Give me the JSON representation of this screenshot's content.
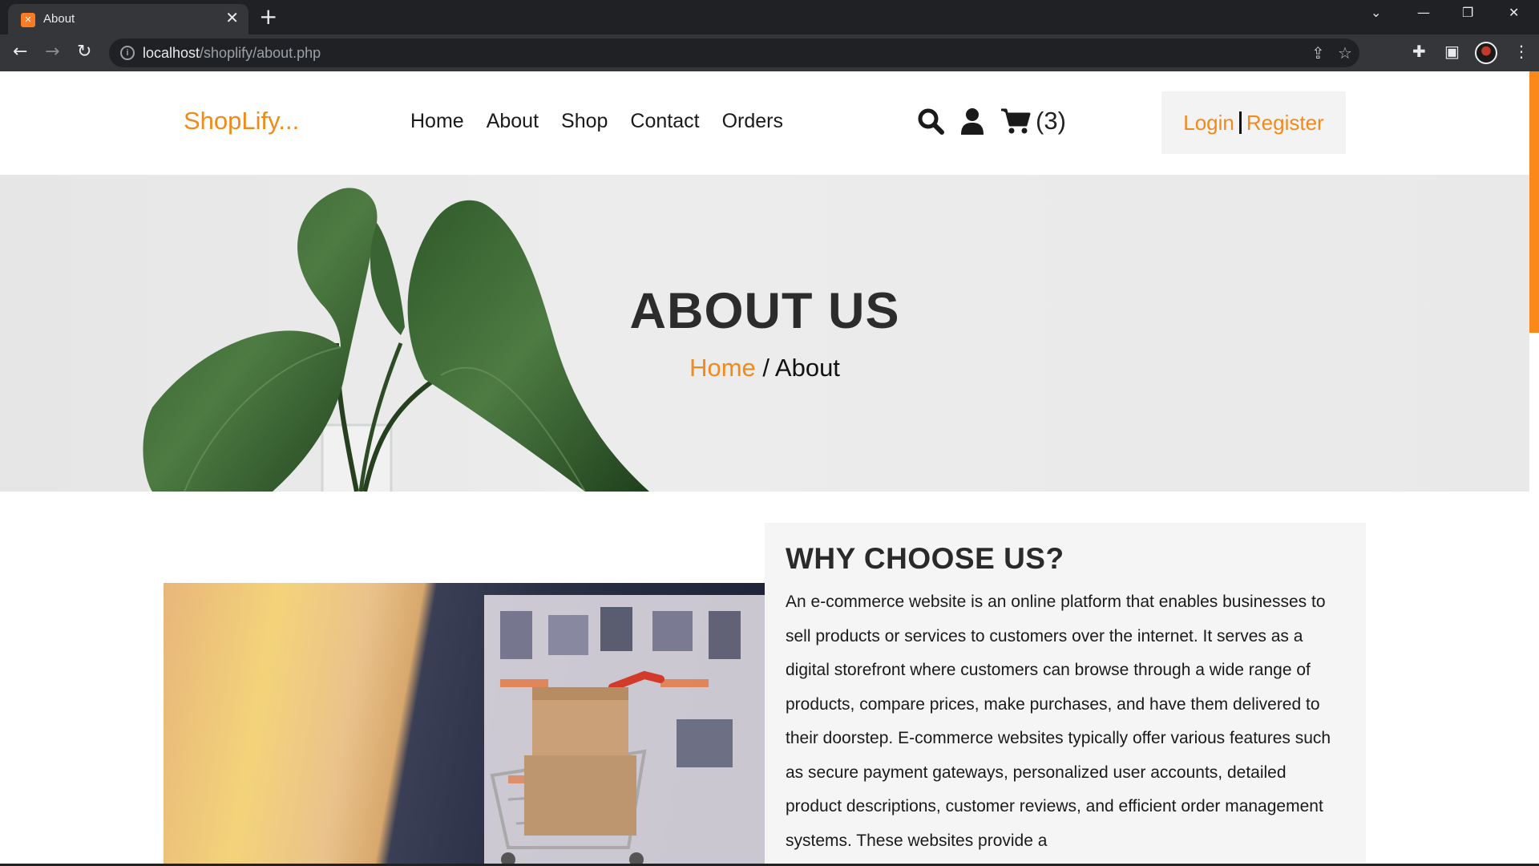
{
  "browser": {
    "tab_title": "About",
    "tab_favicon": "xampp-icon",
    "url_host": "localhost",
    "url_path": "/shoplify/about.php"
  },
  "site": {
    "logo": "ShopLify...",
    "nav": [
      "Home",
      "About",
      "Shop",
      "Contact",
      "Orders"
    ],
    "cart_count": "(3)",
    "login": "Login",
    "register": "Register",
    "accent_color": "#f28a1a"
  },
  "hero": {
    "title": "ABOUT US",
    "breadcrumb_home": "Home",
    "breadcrumb_sep": " / ",
    "breadcrumb_current": "About"
  },
  "about": {
    "title": "WHY CHOOSE US?",
    "text": "An e-commerce website is an online platform that enables businesses to sell products or services to customers over the internet. It serves as a digital storefront where customers can browse through a wide range of products, compare prices, make purchases, and have them delivered to their doorstep. E-commerce websites typically offer various features such as secure payment gateways, personalized user accounts, detailed product descriptions, customer reviews, and efficient order management systems. These websites provide a"
  }
}
